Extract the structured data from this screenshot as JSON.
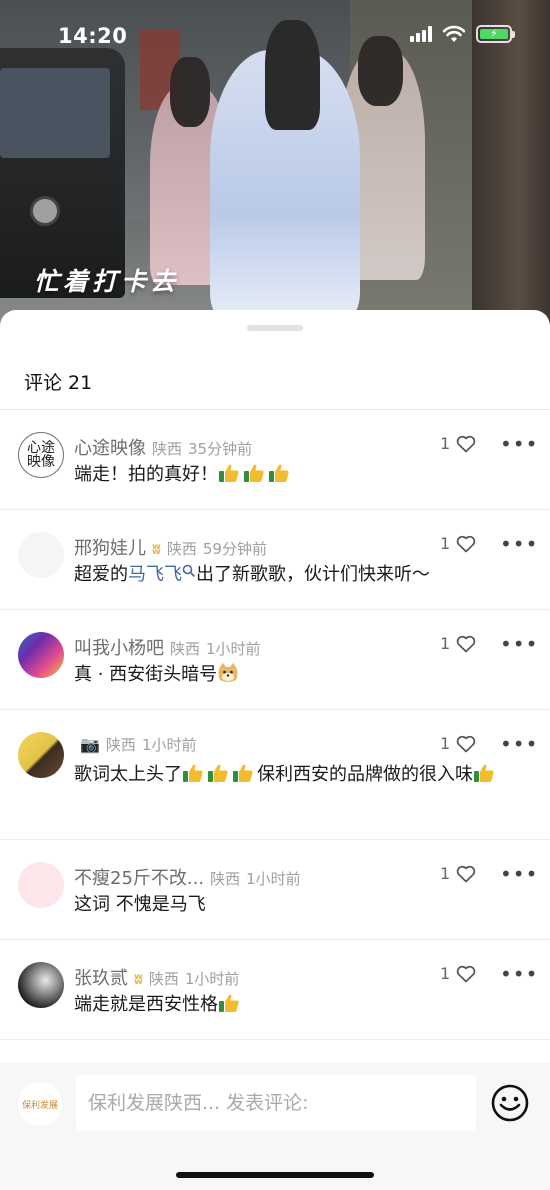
{
  "status_bar": {
    "time": "14:20",
    "battery_icon": "battery-charging-icon",
    "wifi_icon": "wifi-icon",
    "signal_icon": "cellular-signal-icon"
  },
  "video": {
    "caption": "忙着打卡去"
  },
  "sheet": {
    "title": "评论 21"
  },
  "comments": [
    {
      "name": "心途映像",
      "badge": "",
      "location": "陕西",
      "time": "35分钟前",
      "likes": "1",
      "avatar_text": "心途\n映像",
      "text_parts": [
        {
          "t": "端走！拍的真好！"
        },
        {
          "icon": "thumbs-up-emoji"
        },
        {
          "icon": "thumbs-up-emoji"
        },
        {
          "icon": "thumbs-up-emoji"
        }
      ]
    },
    {
      "name": "邢狗娃儿",
      "badge": "ʬ",
      "location": "陕西",
      "time": "59分钟前",
      "likes": "1",
      "text_parts": [
        {
          "t": "超爱的"
        },
        {
          "link": "马飞飞"
        },
        {
          "search": "search-icon"
        },
        {
          "t": "出了新歌歌，伙计们快来听～"
        }
      ]
    },
    {
      "name": "叫我小杨吧",
      "badge": "",
      "location": "陕西",
      "time": "1小时前",
      "likes": "1",
      "text_parts": [
        {
          "t": "真 · 西安街头暗号"
        },
        {
          "icon": "doge-emoji"
        }
      ]
    },
    {
      "name": "",
      "badge": "",
      "location": "陕西",
      "time": "1小时前",
      "likes": "1",
      "text_parts": [
        {
          "t": "歌词太上头了"
        },
        {
          "icon": "thumbs-up-emoji"
        },
        {
          "icon": "thumbs-up-emoji"
        },
        {
          "icon": "thumbs-up-emoji"
        },
        {
          "t": "保利西安的品牌做的很入味"
        },
        {
          "icon": "thumbs-up-emoji"
        }
      ]
    },
    {
      "name": "不瘦25斤不改...",
      "badge": "",
      "location": "陕西",
      "time": "1小时前",
      "likes": "1",
      "text_parts": [
        {
          "t": "这词 不愧是马飞"
        }
      ]
    },
    {
      "name": "张玖贰",
      "badge": "ʬ",
      "location": "陕西",
      "time": "1小时前",
      "likes": "1",
      "text_parts": [
        {
          "t": "端走就是西安性格"
        },
        {
          "icon": "thumbs-up-emoji"
        }
      ]
    }
  ],
  "input_bar": {
    "logo_text": "保利发展",
    "placeholder": "保利发展陕西... 发表评论:",
    "emoji_button": "smiley-icon"
  },
  "colors": {
    "link": "#3f6aa8",
    "badge": "#e9b34b",
    "meta": "#a0a0a0",
    "name": "#6e6e6e"
  }
}
